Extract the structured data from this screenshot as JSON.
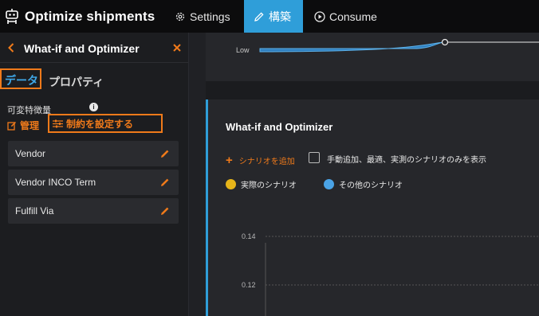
{
  "app": {
    "title": "Optimize shipments"
  },
  "nav": {
    "settings": "Settings",
    "build": "構築",
    "consume": "Consume"
  },
  "panel": {
    "title": "What-if and Optimizer",
    "tabs": {
      "data": "データ",
      "properties": "プロパティ"
    },
    "feature_label": "可変特徴量",
    "manage": "管理",
    "set_constraints": "制約を設定する",
    "variables": [
      "Vendor",
      "Vendor INCO Term",
      "Fulfill Via"
    ]
  },
  "top_chart": {
    "low_label": "Low"
  },
  "optimizer": {
    "title": "What-if and Optimizer",
    "add_scenario": "シナリオを追加",
    "filter_label": "手動追加、最適、実測のシナリオのみを表示",
    "legend": {
      "actual": "実際のシナリオ",
      "other": "その他のシナリオ"
    },
    "y_ticks": [
      "0.14",
      "0.12"
    ]
  },
  "colors": {
    "accent": "#f07a1a",
    "blue": "#2f9ed9",
    "actual_dot": "#e6b419",
    "other_dot": "#4aa3e6"
  },
  "chart_data": {
    "type": "scatter",
    "y_ticks": [
      0.14,
      0.12
    ],
    "grid": true,
    "legend": [
      "実際のシナリオ",
      "その他のシナリオ"
    ]
  }
}
